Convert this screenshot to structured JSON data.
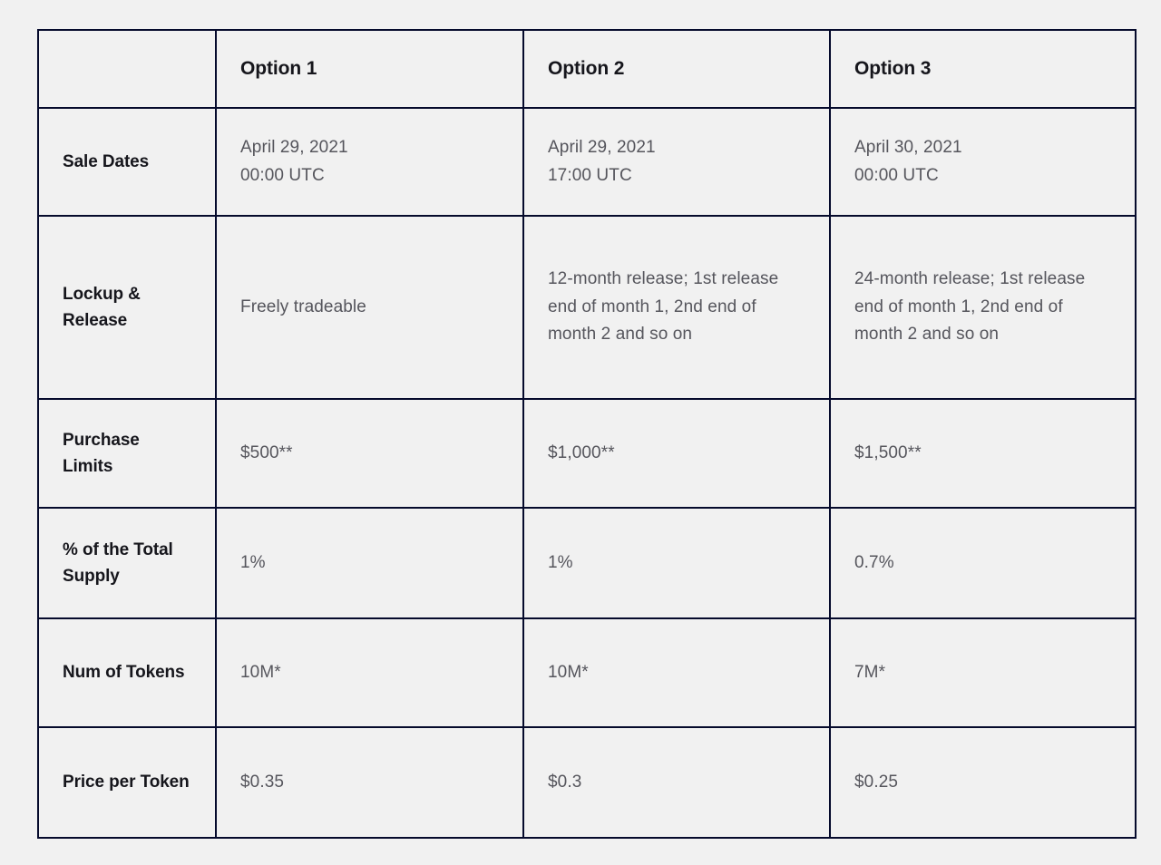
{
  "table": {
    "columns": [
      {
        "id": "label",
        "label": ""
      },
      {
        "id": "opt1",
        "label": "Option 1"
      },
      {
        "id": "opt2",
        "label": "Option 2"
      },
      {
        "id": "opt3",
        "label": "Option 3"
      }
    ],
    "rows": [
      {
        "id": "sale-dates",
        "label": "Sale Dates",
        "values": [
          "April 29, 2021\n00:00 UTC",
          "April 29, 2021\n17:00 UTC",
          "April 30, 2021\n00:00 UTC"
        ]
      },
      {
        "id": "lockup-release",
        "label": "Lockup & Release",
        "values": [
          "Freely tradeable",
          "12-month release; 1st release end of month 1, 2nd end of month 2 and so on",
          "24-month release; 1st release end of month 1, 2nd end of month 2 and so on"
        ]
      },
      {
        "id": "purchase-limits",
        "label": "Purchase Limits",
        "values": [
          "$500**",
          "$1,000**",
          "$1,500**"
        ]
      },
      {
        "id": "percent-total-supply",
        "label": "% of the Total Supply",
        "values": [
          "1%",
          "1%",
          "0.7%"
        ]
      },
      {
        "id": "num-of-tokens",
        "label": "Num of Tokens",
        "values": [
          "10M*",
          "10M*",
          "7M*"
        ]
      },
      {
        "id": "price-per-token",
        "label": "Price per Token",
        "values": [
          "$0.35",
          "$0.3",
          "$0.25"
        ]
      }
    ]
  },
  "colors": {
    "background": "#f1f1f1",
    "border": "#050a2c",
    "heading_text": "#16161c",
    "body_text": "#55555c"
  }
}
